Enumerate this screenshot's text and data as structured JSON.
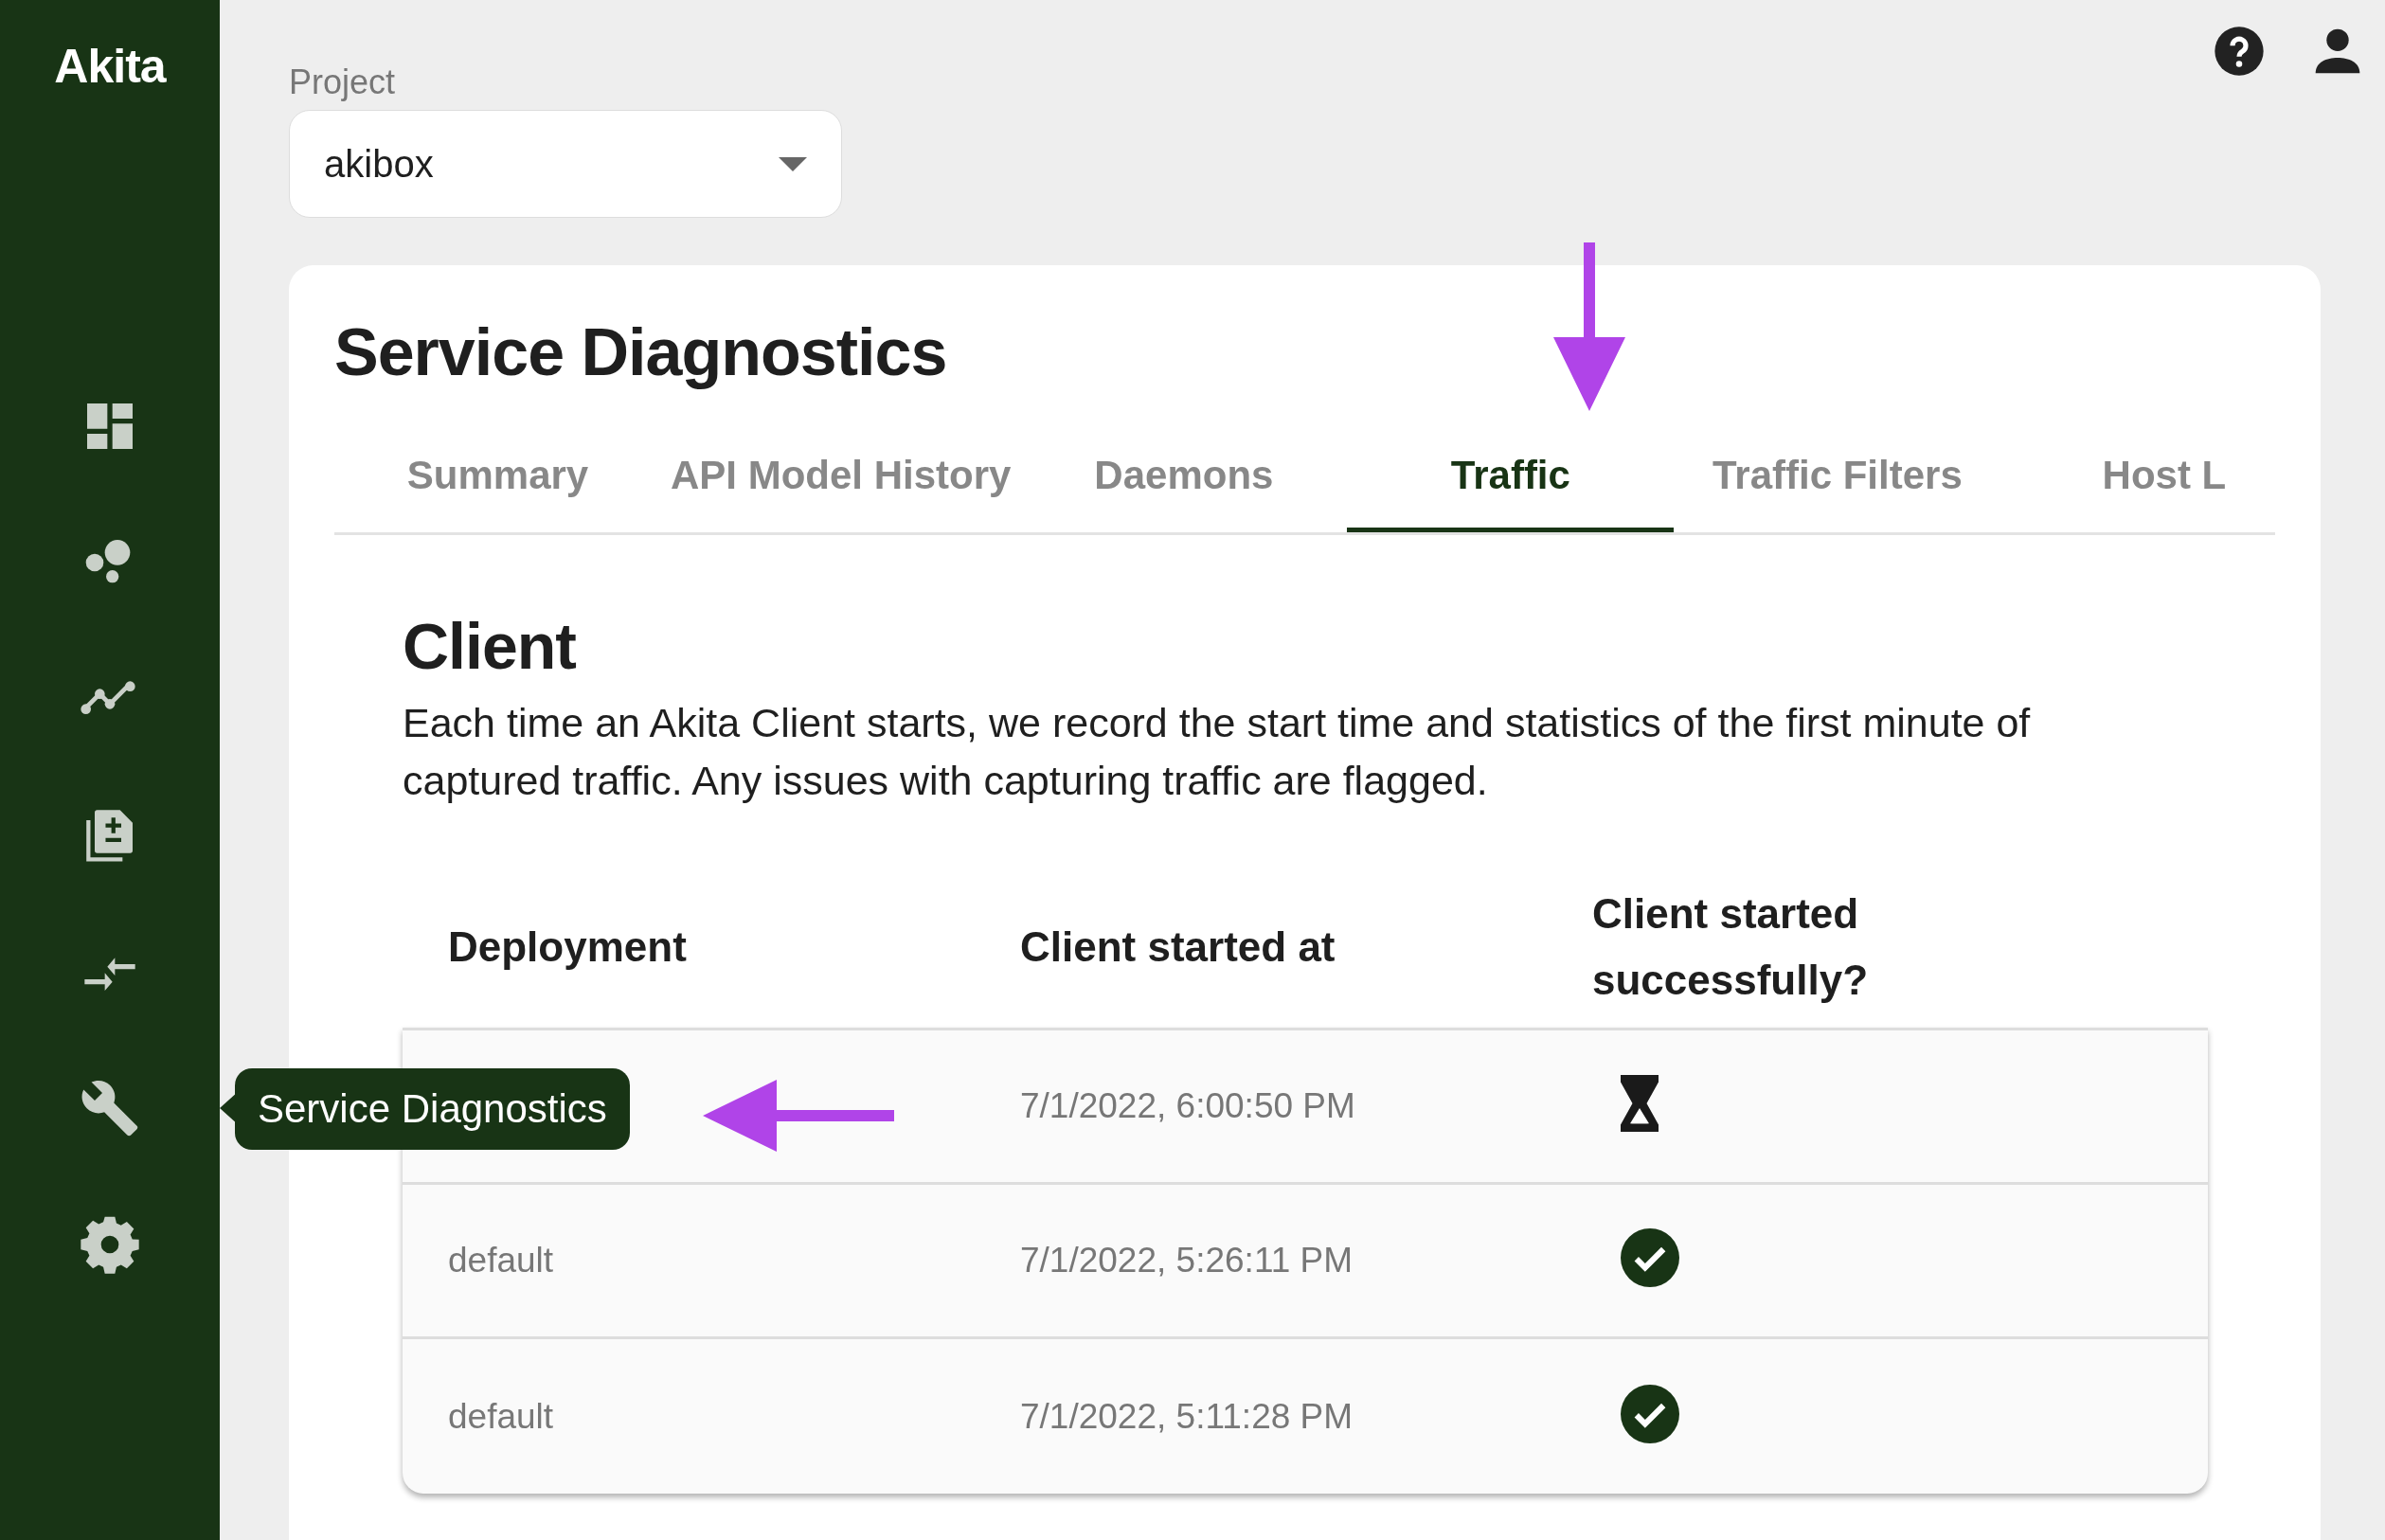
{
  "sidebar": {
    "logo": "Akita",
    "tooltip": "Service Diagnostics"
  },
  "project": {
    "label": "Project",
    "value": "akibox"
  },
  "card": {
    "title": "Service Diagnostics",
    "tabs": [
      {
        "label": "Summary",
        "selected": false
      },
      {
        "label": "API Model History",
        "selected": false
      },
      {
        "label": "Daemons",
        "selected": false
      },
      {
        "label": "Traffic",
        "selected": true
      },
      {
        "label": "Traffic Filters",
        "selected": false
      },
      {
        "label": "Host L",
        "selected": false
      }
    ],
    "section": {
      "heading": "Client",
      "description": "Each time an Akita Client starts, we record the start time and statistics of the first minute of captured traffic. Any issues with capturing traffic are flagged."
    },
    "table": {
      "columns": [
        "Deployment",
        "Client started at",
        "Client started successfully?"
      ],
      "rows": [
        {
          "started_at": "7/1/2022, 6:00:50 PM",
          "kind": "pending"
        },
        {
          "deployment": "default",
          "started_at": "7/1/2022, 5:26:11 PM",
          "kind": "success"
        },
        {
          "deployment": "default",
          "started_at": "7/1/2022, 5:11:28 PM",
          "kind": "success"
        }
      ]
    }
  }
}
